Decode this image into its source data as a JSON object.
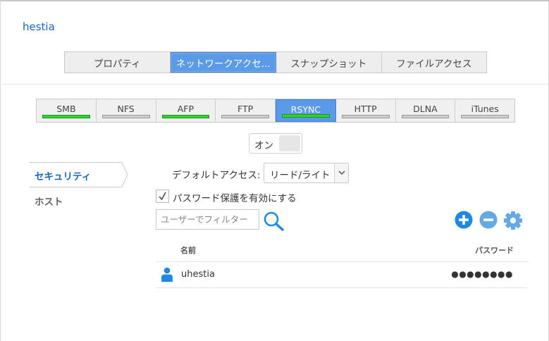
{
  "app": {
    "title": "hestia"
  },
  "main_tabs": [
    {
      "label": "プロパティ",
      "active": false
    },
    {
      "label": "ネットワークアクセ...",
      "active": true
    },
    {
      "label": "スナップショット",
      "active": false
    },
    {
      "label": "ファイルアクセス",
      "active": false
    }
  ],
  "service_tabs": [
    {
      "label": "SMB",
      "status": "enabled",
      "active": false
    },
    {
      "label": "NFS",
      "status": "disabled",
      "active": false
    },
    {
      "label": "AFP",
      "status": "enabled",
      "active": false
    },
    {
      "label": "FTP",
      "status": "disabled",
      "active": false
    },
    {
      "label": "RSYNC",
      "status": "enabled",
      "active": true
    },
    {
      "label": "HTTP",
      "status": "disabled",
      "active": false
    },
    {
      "label": "DLNA",
      "status": "disabled",
      "active": false
    },
    {
      "label": "iTunes",
      "status": "disabled",
      "active": false
    }
  ],
  "toggle": {
    "label": "オン"
  },
  "sidebar": {
    "items": [
      {
        "label": "セキュリティ",
        "active": true
      },
      {
        "label": "ホスト",
        "active": false
      }
    ]
  },
  "security": {
    "default_access_label": "デフォルトアクセス:",
    "default_access_value": "リード/ライト",
    "password_protect_label": "パスワード保護を有効にする",
    "password_protect_checked": true,
    "filter_placeholder": "ユーザーでフィルター",
    "table": {
      "headers": {
        "name": "名前",
        "password": "パスワード"
      },
      "rows": [
        {
          "name": "uhestia",
          "password": "●●●●●●●●"
        }
      ]
    }
  },
  "icons": {
    "search": "search-icon",
    "add": "add-circle-icon",
    "remove": "remove-circle-icon",
    "settings": "gear-icon",
    "user": "user-icon",
    "check": "checkmark-icon",
    "dropdown": "chevron-down-icon"
  },
  "colors": {
    "accent": "#1565c0",
    "active_tab": "#5b9ae6",
    "status_on": "#2fd62f",
    "status_off": "#cfcfcf",
    "action_blue": "#1e88e5",
    "action_light": "#64a8e6"
  }
}
